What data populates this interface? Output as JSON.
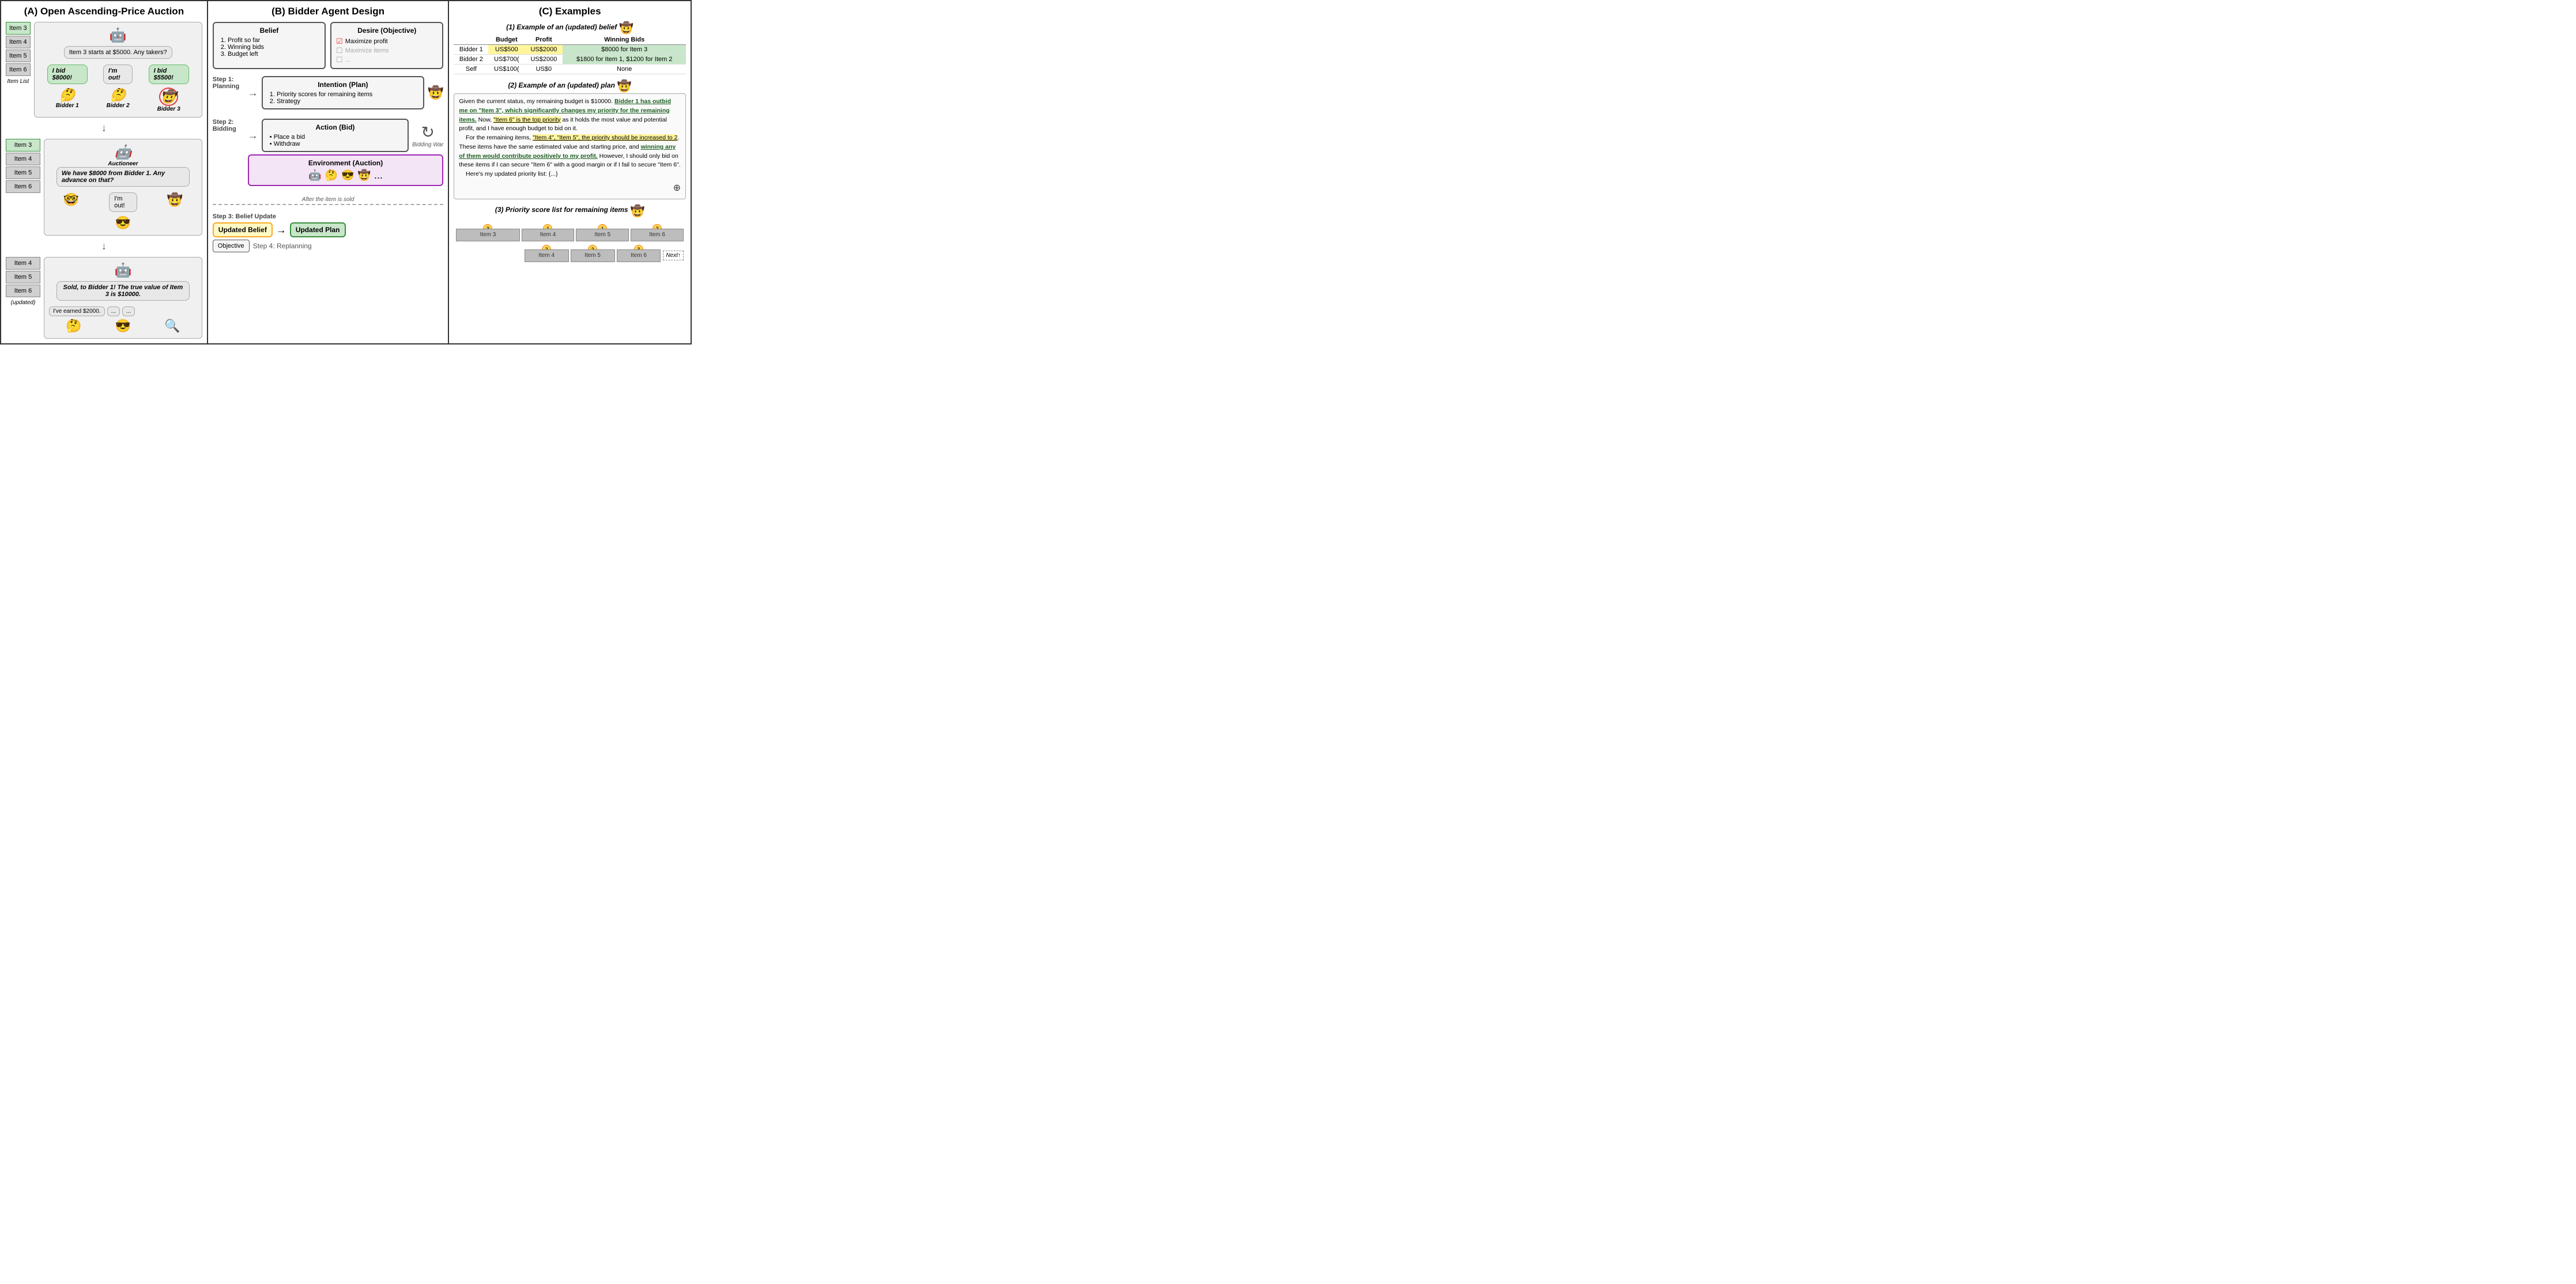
{
  "panelA": {
    "title": "(A) Open Ascending-Price Auction",
    "scene1": {
      "auctioneer_speech": "Item 3 starts at $5000. Any takers?",
      "bidder1_speech": "I bid $8000!",
      "bidder2_speech": "I'm out!",
      "bidder3_speech": "I bid $5500!",
      "bidder1_label": "Bidder 1",
      "bidder2_label": "Bidder 2",
      "bidder3_label": "Bidder 3"
    },
    "scene2": {
      "auctioneer_speech": "We have $8000 from Bidder 1. Any advance on that?",
      "auctioneer_label": "Auctioneer",
      "bidder2_speech": "I'm out!",
      "bidder1_emoji": "🤓",
      "bidder2_emoji": "😎",
      "bidder3_emoji": "🤠"
    },
    "scene3": {
      "auctioneer_speech": "Sold, to Bidder 1! The true value of Item 3 is $10000.",
      "bidder1_speech": "I've earned $2000.",
      "bidder2_speech": "...",
      "bidder3_speech": "..."
    },
    "items": [
      "Item 3",
      "Item 4",
      "Item 5",
      "Item 6"
    ],
    "items_updated": [
      "Item 4",
      "Item 5",
      "Item 6"
    ],
    "item_list_label": "Item List",
    "updated_label": "(updated)"
  },
  "panelB": {
    "title": "(B) Bidder Agent Design",
    "belief_title": "Belief",
    "belief_items": [
      "1. Profit so far",
      "2. Winning bids",
      "3. Budget left"
    ],
    "desire_title": "Desire (Objective)",
    "desire_items": [
      {
        "label": "Maximize profit",
        "checked": true
      },
      {
        "label": "Maximize items",
        "checked": false
      },
      {
        "label": "...",
        "checked": false
      }
    ],
    "intention_title": "Intention (Plan)",
    "intention_items": [
      "1. Priority scores for remaining items",
      "2. Strategy"
    ],
    "action_title": "Action (Bid)",
    "action_items": [
      "Place a bid",
      "Withdraw"
    ],
    "environment_title": "Environment (Auction)",
    "step1_label": "Step 1:\nPlanning",
    "step2_label": "Step 2:\nBidding",
    "step3_label": "Step 3: Belief Update",
    "step4_label": "Step 4: Replanning",
    "bidding_war_label": "Bidding War",
    "after_sold_label": "After the item is sold",
    "updated_belief_label": "Updated Belief",
    "updated_plan_label": "Updated Plan",
    "objective_label": "Objective"
  },
  "panelC": {
    "title": "(C) Examples",
    "example1": {
      "title": "(1) Example of an (updated) belief",
      "headers": [
        "",
        "Budget",
        "Profit",
        "Winning Bids"
      ],
      "rows": [
        {
          "name": "Bidder 1",
          "budget": "US$500",
          "profit": "US$2000",
          "bids": "$8000 for Item 3",
          "budget_class": "yellow",
          "profit_class": "yellow"
        },
        {
          "name": "Bidder 2",
          "budget": "US$700(",
          "profit": "US$2000",
          "bids": "$1800 for Item 1, $1200 for Item 2",
          "bids_class": "green"
        },
        {
          "name": "Self",
          "budget": "US$100(",
          "profit": "US$0",
          "bids": "None"
        }
      ]
    },
    "example2": {
      "title": "(2) Example of an (updated) plan",
      "text_parts": [
        {
          "text": "Given the current status, my remaining budget is $10000. ",
          "style": "normal"
        },
        {
          "text": "Bidder 1 has outbid me on \"Item 3\", which significantly changes my priority for the remaining items.",
          "style": "underline-green"
        },
        {
          "text": " Now, ",
          "style": "normal"
        },
        {
          "text": "\"Item 6\" is the top priority",
          "style": "underline-yellow"
        },
        {
          "text": " as it holds the most value and potential profit, and I have enough budget to bid on it.",
          "style": "normal"
        },
        {
          "text": "\n    For the remaining items, ",
          "style": "normal"
        },
        {
          "text": "\"Item 4\", \"Item 5\", the priority should be increased to 2",
          "style": "underline-yellow"
        },
        {
          "text": ". These items have the same estimated value and starting price, and ",
          "style": "normal"
        },
        {
          "text": "winning any of them would contribute positively to my profit.",
          "style": "underline-green"
        },
        {
          "text": " However, I should only bid on these items if I can secure \"Item 6\" with a good margin or if I fail to secure \"Item 6\".",
          "style": "normal"
        },
        {
          "text": "\n    Here's my updated priority list: {...}",
          "style": "normal"
        }
      ]
    },
    "example3": {
      "title": "(3) Priority score list for remaining items",
      "row1": {
        "bars": [
          {
            "label": "Item 3",
            "badge": "3",
            "width_pct": 25
          },
          {
            "label": "Item 4",
            "badge": "1",
            "width_pct": 20
          },
          {
            "label": "Item 5",
            "badge": "1",
            "width_pct": 20
          },
          {
            "label": "Item 6",
            "badge": "2",
            "width_pct": 20
          }
        ]
      },
      "row2": {
        "bars": [
          {
            "label": "Item 4",
            "badge": "2",
            "width_pct": 20
          },
          {
            "label": "Item 5",
            "badge": "2",
            "width_pct": 20
          },
          {
            "label": "Item 6",
            "badge": "3",
            "width_pct": 20
          }
        ]
      },
      "next_label": "Next↑"
    }
  }
}
